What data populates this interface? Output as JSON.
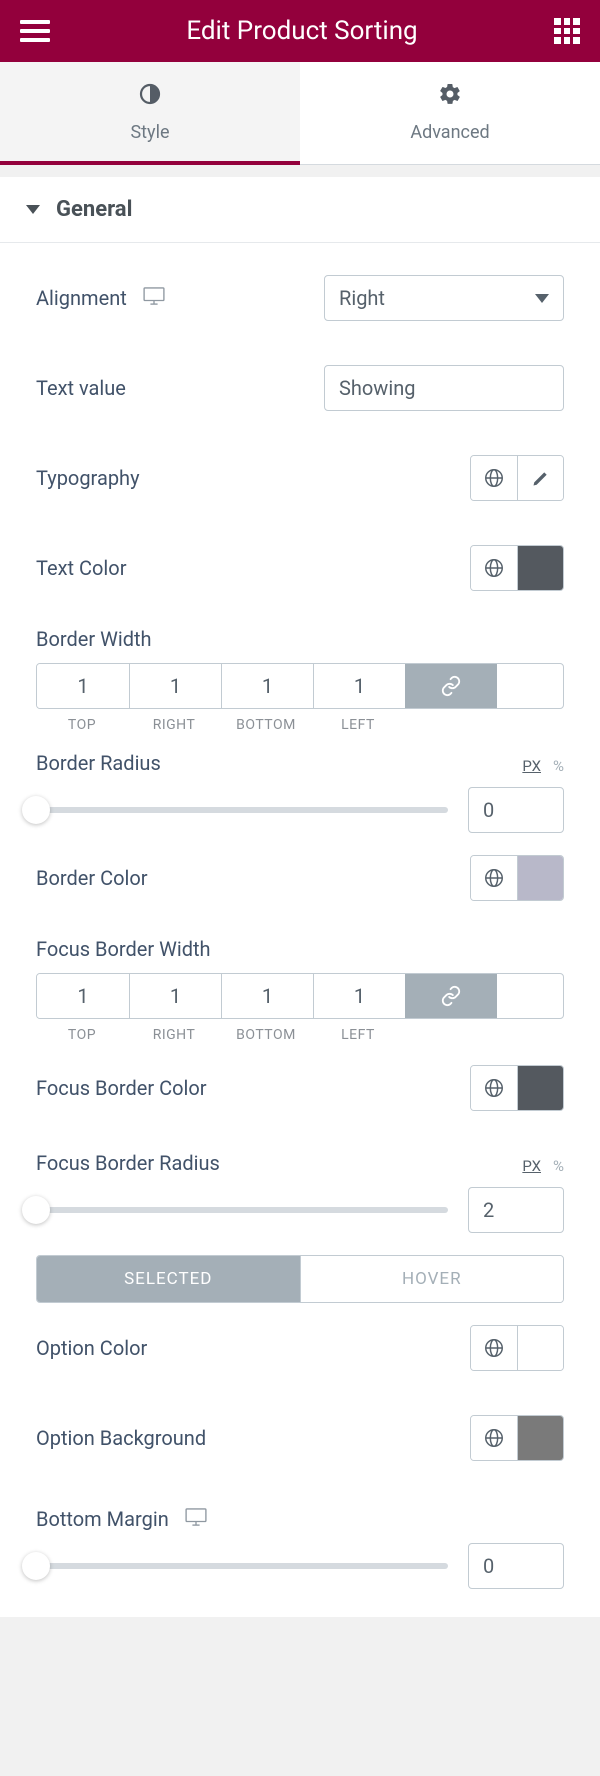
{
  "header": {
    "title": "Edit Product Sorting"
  },
  "tabs": {
    "style": "Style",
    "advanced": "Advanced"
  },
  "section": {
    "title": "General"
  },
  "labels": {
    "alignment": "Alignment",
    "text_value": "Text value",
    "typography": "Typography",
    "text_color": "Text Color",
    "border_width": "Border Width",
    "border_radius": "Border Radius",
    "border_color": "Border Color",
    "focus_border_width": "Focus Border Width",
    "focus_border_color": "Focus Border Color",
    "focus_border_radius": "Focus Border Radius",
    "option_color": "Option Color",
    "option_background": "Option Background",
    "bottom_margin": "Bottom Margin"
  },
  "values": {
    "alignment": "Right",
    "text_value": "Showing",
    "border_width": {
      "top": "1",
      "right": "1",
      "bottom": "1",
      "left": "1"
    },
    "border_radius": "0",
    "focus_border_width": {
      "top": "1",
      "right": "1",
      "bottom": "1",
      "left": "1"
    },
    "focus_border_radius": "2",
    "bottom_margin": "0"
  },
  "units": {
    "px": "PX",
    "pct": "%"
  },
  "dims": {
    "top": "TOP",
    "right": "RIGHT",
    "bottom": "BOTTOM",
    "left": "LEFT"
  },
  "state_tabs": {
    "selected": "SELECTED",
    "hover": "HOVER"
  },
  "colors": {
    "text": "#54595F",
    "border": "#b8b8c9",
    "focus_border": "#54595F",
    "option_bg": "#7a7a7a"
  }
}
